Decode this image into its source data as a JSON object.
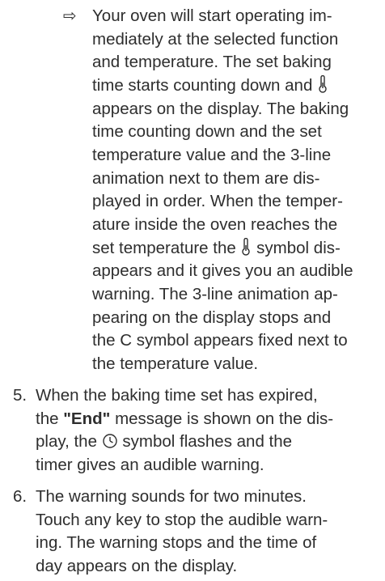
{
  "result": {
    "arrow": "⇨",
    "lines": [
      {
        "a": "Your oven will start operating im-"
      },
      {
        "a": "mediately at the selected function"
      },
      {
        "a": "and temperature. The set baking"
      },
      {
        "a": "time starts counting down and ",
        "icon": "thermometer-icon"
      },
      {
        "a": "appears on the display. The baking"
      },
      {
        "a": "time counting down and the set"
      },
      {
        "a": "temperature value and the 3-line"
      },
      {
        "a": "animation next to them are dis-"
      },
      {
        "a": "played in order. When the temper-"
      },
      {
        "a": "ature inside the oven reaches the"
      },
      {
        "a": "set temperature the ",
        "icon": "thermometer-icon",
        "b": " symbol dis-"
      },
      {
        "a": "appears and it gives you an audible"
      },
      {
        "a": "warning. The 3-line animation ap-"
      },
      {
        "a": "pearing on the display stops and"
      },
      {
        "a": "the C symbol appears fixed next to"
      },
      {
        "a": "the temperature value."
      }
    ]
  },
  "steps": [
    {
      "number": "5.",
      "lines": [
        {
          "a": "When the baking time set has expired,"
        },
        {
          "a": "the ",
          "bold": "\"End\"",
          "b": " message is shown on the dis-"
        },
        {
          "a": "play, the ",
          "icon": "clock-icon",
          "b": " symbol flashes and the"
        },
        {
          "a": "timer gives an audible warning."
        }
      ]
    },
    {
      "number": "6.",
      "lines": [
        {
          "a": "The warning sounds for two minutes."
        },
        {
          "a": "Touch any key to stop the audible warn-"
        },
        {
          "a": "ing. The warning stops and the time of"
        },
        {
          "a": "day appears on the display."
        }
      ]
    }
  ]
}
